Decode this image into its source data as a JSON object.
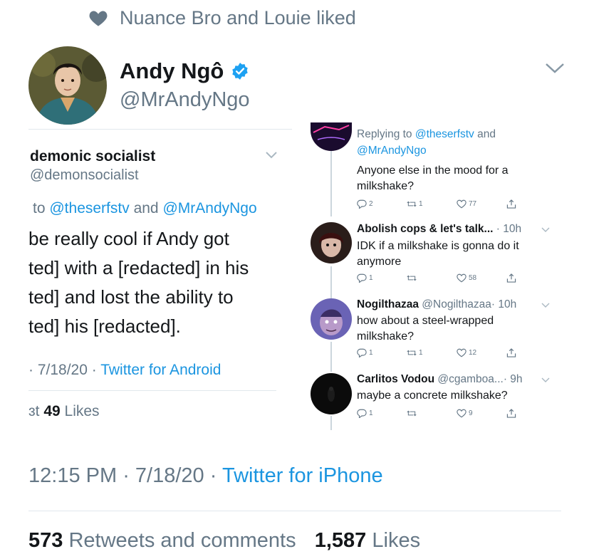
{
  "social_context": {
    "text": "Nuance Bro and Louie liked"
  },
  "tweet": {
    "name": "Andy Ngô",
    "handle": "@MrAndyNgo",
    "time": "12:15 PM",
    "date": "7/18/20",
    "source": "Twitter for iPhone",
    "retweets_count": "573",
    "retweets_label": "Retweets and comments",
    "likes_count": "1,587",
    "likes_label": "Likes"
  },
  "left_tweet": {
    "name": "demonic socialist",
    "handle": "@demonsocialist",
    "reply_prefix": "to",
    "reply_to_1": "@theserfstv",
    "reply_and": "and",
    "reply_to_2": "@MrAndyNgo",
    "lines": [
      "be really cool if Andy got",
      "ted] with a [redacted] in his",
      "ted] and lost the ability to",
      "ted] his [redacted]."
    ],
    "date": "· 7/18/20 ·",
    "source": "Twitter for Android",
    "likes_prefix": "ɜt",
    "likes_count": "49",
    "likes_label": "Likes"
  },
  "replies": [
    {
      "reply_prefix": "Replying to",
      "reply_to_1": "@theserfstv",
      "reply_and": "and",
      "reply_to_2": "@MrAndyNgo",
      "text": "Anyone else in the mood for a milkshake?",
      "counts": {
        "reply": "2",
        "retweet": "1",
        "like": "77"
      }
    },
    {
      "name": "Abolish cops & let's talk...",
      "time": "· 10h",
      "text": "IDK if a milkshake is gonna do it anymore",
      "counts": {
        "reply": "1",
        "retweet": "",
        "like": "58"
      }
    },
    {
      "name": "Nogilthazaa",
      "handle": "@Nogilthazaa",
      "time": "· 10h",
      "text": "how about a steel-wrapped milkshake?",
      "counts": {
        "reply": "1",
        "retweet": "1",
        "like": "12"
      }
    },
    {
      "name": "Carlitos Vodou",
      "handle": "@cgamboa...",
      "time": "· 9h",
      "text": "maybe a concrete milkshake?",
      "counts": {
        "reply": "1",
        "retweet": "",
        "like": "9"
      }
    }
  ],
  "colors": {
    "link": "#1b95e0",
    "secondary": "#657786",
    "verified": "#1da1f2",
    "divider": "#e1e8ed"
  }
}
